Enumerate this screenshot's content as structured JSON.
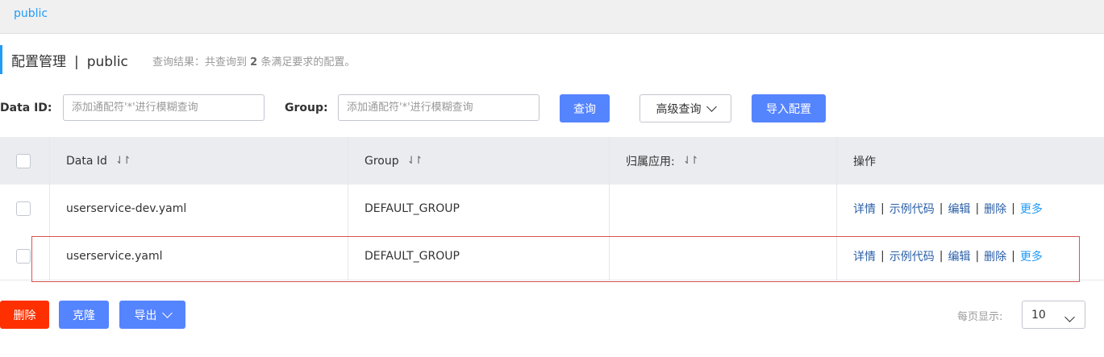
{
  "topbar": {
    "tab": "public"
  },
  "page": {
    "title": "配置管理",
    "separator": "|",
    "namespace": "public",
    "result_prefix": "查询结果：共查询到",
    "result_count": "2",
    "result_suffix": "条满足要求的配置。"
  },
  "search": {
    "dataid_label": "Data ID:",
    "dataid_placeholder": "添加通配符'*'进行模糊查询",
    "group_label": "Group:",
    "group_placeholder": "添加通配符'*'进行模糊查询",
    "query_button": "查询",
    "advanced_button": "高级查询",
    "import_button": "导入配置"
  },
  "table": {
    "headers": {
      "data_id": "Data Id",
      "group": "Group",
      "app": "归属应用:",
      "actions": "操作"
    },
    "sort_icon": "⇃↾",
    "rows": [
      {
        "data_id": "userservice-dev.yaml",
        "group": "DEFAULT_GROUP",
        "app": ""
      },
      {
        "data_id": "userservice.yaml",
        "group": "DEFAULT_GROUP",
        "app": ""
      }
    ],
    "actions": {
      "detail": "详情",
      "sample": "示例代码",
      "edit": "编辑",
      "delete": "删除",
      "more": "更多",
      "pipe": "|"
    }
  },
  "footer": {
    "delete_button": "删除",
    "clone_button": "克隆",
    "export_button": "导出",
    "page_size_label": "每页显示:",
    "page_size_value": "10"
  },
  "colors": {
    "primary": "#5584ff",
    "danger": "#ff3000",
    "link": "#2a5fa8",
    "accent": "#209bfa",
    "highlight": "#d9534f"
  }
}
